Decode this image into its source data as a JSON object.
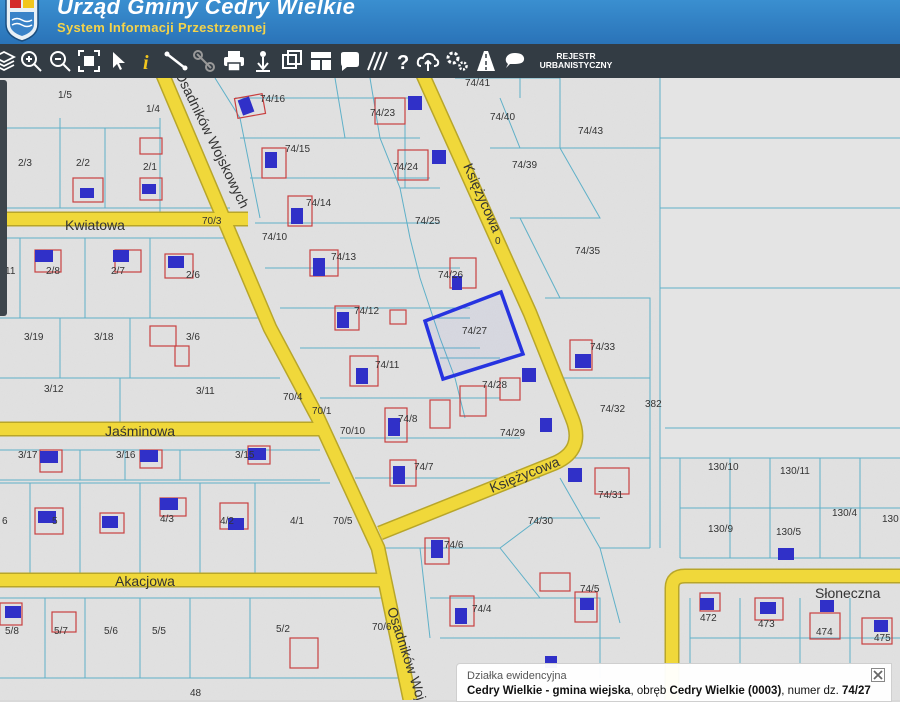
{
  "header": {
    "title": "Urząd Gminy Cedry Wielkie",
    "subtitle": "System Informacji Przestrzennej"
  },
  "toolbar": {
    "tools": [
      "layers-icon",
      "zoom-in-icon",
      "zoom-out-icon",
      "full-extent-icon",
      "select-cursor-icon",
      "info-icon",
      "measure-distance-icon",
      "measure-link-icon",
      "print-icon",
      "download-icon",
      "export-icon",
      "layout-icon",
      "comment-icon",
      "hatch-icon",
      "help-icon",
      "cloud-upload-icon",
      "settings-icon",
      "road-icon",
      "chat-icon"
    ],
    "rejestr_label_1": "REJESTR",
    "rejestr_label_2": "URBANISTYCZNY"
  },
  "map": {
    "streets": {
      "kwiatowa": "Kwiatowa",
      "jasminowa": "Jaśminowa",
      "akacjowa": "Akacjowa",
      "osadnikow_1": "Osadników Wojskowych",
      "osadnikow_2": "Osadników Woj",
      "ksiezycowa_1": "Księżycowa",
      "ksiezycowa_2": "Księżycowa",
      "sloneczna": "Słoneczna"
    },
    "parcels": [
      "1/5",
      "1/4",
      "2/3",
      "2/2",
      "2/1",
      "11",
      "2/8",
      "2/7",
      "2/6",
      "3/19",
      "3/18",
      "3/6",
      "3/12",
      "3/11",
      "3/17",
      "3/16",
      "3/15",
      "6",
      "5",
      "4/3",
      "4/2",
      "4/1",
      "5/8",
      "5/7",
      "5/6",
      "5/5",
      "5/2",
      "48",
      "74/16",
      "74/15",
      "74/14",
      "74/10",
      "74/13",
      "74/12",
      "74/11",
      "74/8",
      "74/7",
      "74/6",
      "74/5",
      "74/4",
      "74/23",
      "74/24",
      "74/25",
      "74/26",
      "74/27",
      "74/28",
      "74/29",
      "74/30",
      "74/31",
      "74/32",
      "74/33",
      "74/35",
      "74/39",
      "74/40",
      "74/41",
      "74/43",
      "70/3",
      "70/4",
      "70/1",
      "70/10",
      "70/5",
      "70/6",
      "382",
      "130/10",
      "130/11",
      "130/9",
      "130/5",
      "130/4",
      "130",
      "472",
      "473",
      "474",
      "475",
      "0"
    ],
    "selected_parcel": "74/27"
  },
  "info": {
    "title": "Działka ewidencyjna",
    "gmina": "Cedry Wielkie - gmina wiejska",
    "sep1": ", obręb ",
    "obreb": "Cedry Wielkie (0003)",
    "sep2": ", numer dz.",
    "numer": "74/27"
  },
  "colors": {
    "road": "#f0d83a",
    "parcel_line": "#5fb0c8",
    "building": "#c84040",
    "address": "#2a2ac8",
    "selection": "#2633e0"
  }
}
